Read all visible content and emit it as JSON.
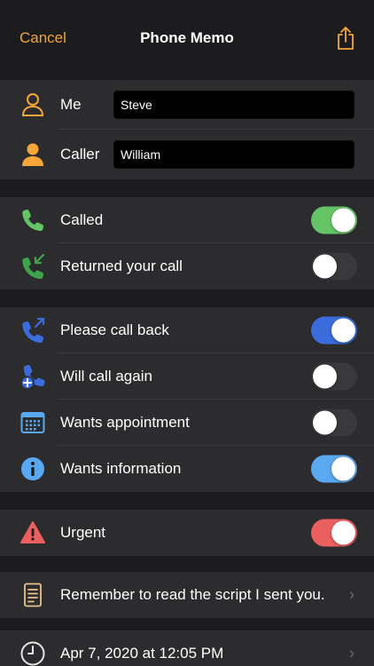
{
  "nav": {
    "cancel_label": "Cancel",
    "title": "Phone Memo",
    "share_icon": "share-icon"
  },
  "colors": {
    "accent": "#f5a53a",
    "green": "#65c466",
    "blue": "#3a6ddb",
    "light_blue": "#5aa8f0",
    "red": "#ec5f5f",
    "toggle_off": "#39393d",
    "row_bg": "#2c2c2e",
    "bg": "#1c1c1e"
  },
  "people": {
    "me": {
      "label": "Me",
      "value": "Steve",
      "icon": "person-outline-icon"
    },
    "caller": {
      "label": "Caller",
      "value": "William",
      "icon": "person-filled-icon"
    }
  },
  "call_status": [
    {
      "label": "Called",
      "on": true,
      "icon": "phone-icon"
    },
    {
      "label": "Returned your call",
      "on": false,
      "icon": "incoming-call-icon"
    }
  ],
  "requests": [
    {
      "label": "Please call back",
      "on": true,
      "icon": "outgoing-call-icon"
    },
    {
      "label": "Will call again",
      "on": false,
      "icon": "phone-add-icon"
    },
    {
      "label": "Wants appointment",
      "on": false,
      "icon": "calendar-icon"
    },
    {
      "label": "Wants information",
      "on": true,
      "icon": "info-icon"
    }
  ],
  "urgent": {
    "label": "Urgent",
    "on": true,
    "icon": "warning-icon"
  },
  "note": {
    "text": "Remember to read the script I sent you.",
    "icon": "note-icon"
  },
  "datetime": {
    "text": "Apr 7, 2020 at 12:05 PM",
    "icon": "clock-icon"
  }
}
